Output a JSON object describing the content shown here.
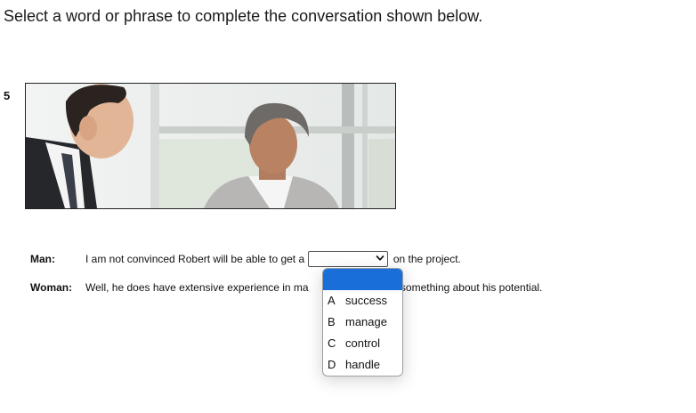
{
  "instruction": "Select a word or phrase to complete the conversation shown below.",
  "question_number": "5",
  "conversation": {
    "man": {
      "speaker": "Man:",
      "before": "I am not convinced Robert will be able to get a",
      "after": "on the project."
    },
    "woman": {
      "speaker": "Woman:",
      "before": "Well, he does have extensive experience in ma",
      "after": "ys something about his potential."
    }
  },
  "dropdown": {
    "selected": "",
    "options": [
      {
        "letter": "A",
        "label": "success"
      },
      {
        "letter": "B",
        "label": "manage"
      },
      {
        "letter": "C",
        "label": "control"
      },
      {
        "letter": "D",
        "label": "handle"
      }
    ],
    "highlight_color": "#1a6ed8"
  },
  "icons": {
    "dropdown_arrow": "chevron-down-icon"
  }
}
